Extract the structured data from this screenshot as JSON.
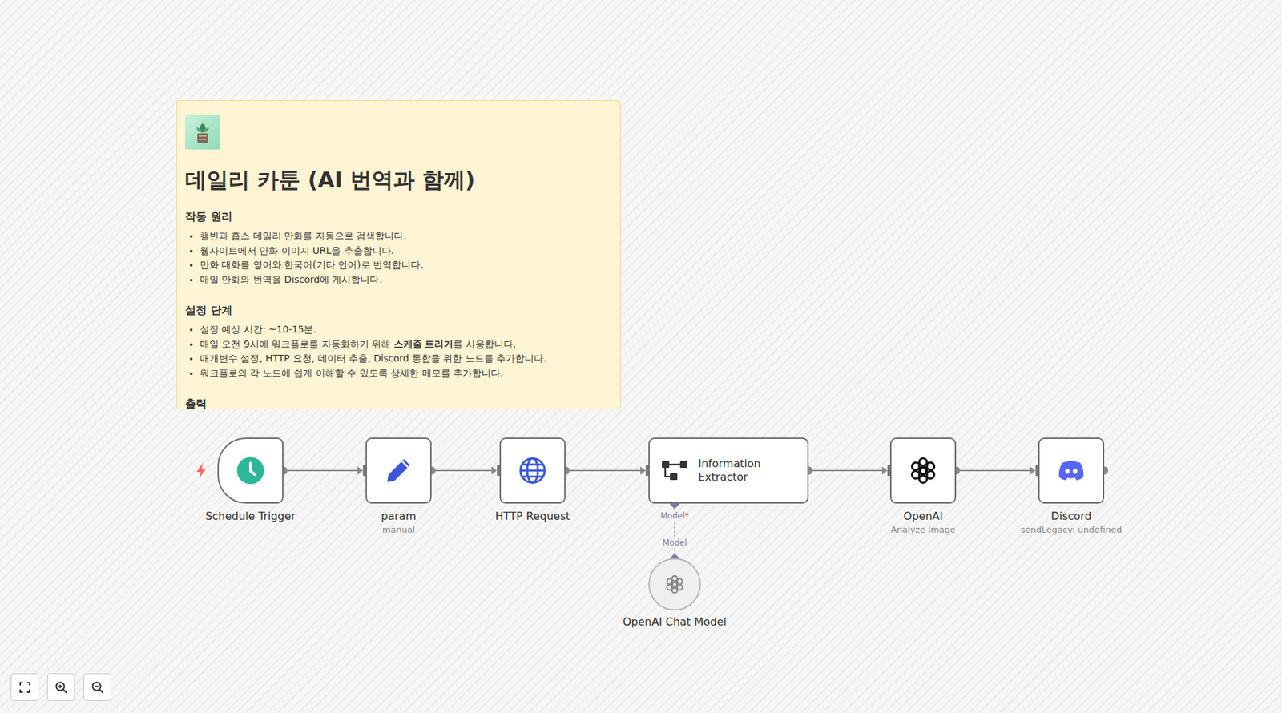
{
  "note": {
    "title": "데일리 카툰 (AI 번역과 함께)",
    "sections": [
      {
        "heading": "작동 원리",
        "items": [
          [
            {
              "text": "캘빈과 홉스 데일리 만화를 자동으로 검색합니다.",
              "bold": false
            }
          ],
          [
            {
              "text": "웹사이트에서 만화 이미지 URL을 추출합니다.",
              "bold": false
            }
          ],
          [
            {
              "text": "만화 대화를 영어와 한국어(기타 언어)로 번역합니다.",
              "bold": false
            }
          ],
          [
            {
              "text": "매일 만화와 번역을 Discord에 게시합니다.",
              "bold": false
            }
          ]
        ]
      },
      {
        "heading": "설정 단계",
        "items": [
          [
            {
              "text": "설정 예상 시간: ~10-15분.",
              "bold": false
            }
          ],
          [
            {
              "text": "매일 오전 9시에 워크플로를 자동화하기 위해 ",
              "bold": false
            },
            {
              "text": "스케줄 트리거",
              "bold": true
            },
            {
              "text": "를 사용합니다.",
              "bold": false
            }
          ],
          [
            {
              "text": "매개변수 설정, HTTP 요청, 데이터 추출, Discord 통합을 위한 노드를 추가합니다.",
              "bold": false
            }
          ],
          [
            {
              "text": "워크플로의 각 노드에 쉽게 이해할 수 있도록 상세한 메모를 추가합니다.",
              "bold": false
            }
          ]
        ]
      },
      {
        "heading": "출력",
        "items": []
      }
    ]
  },
  "nodes": [
    {
      "label": "Schedule Trigger",
      "kind": "schedule"
    },
    {
      "label": "param",
      "subtitle": "manual",
      "kind": "set"
    },
    {
      "label": "HTTP Request",
      "kind": "http"
    },
    {
      "label": "Information Extractor",
      "kind": "extractor"
    },
    {
      "label": "OpenAI",
      "subtitle": "Analyze Image",
      "kind": "openai"
    },
    {
      "label": "Discord",
      "subtitle": "sendLegacy: undefined",
      "kind": "discord"
    }
  ],
  "sub_node": {
    "label": "OpenAI Chat Model",
    "kind": "chat-model"
  },
  "model_port": {
    "label": "Model",
    "required_mark": "*"
  },
  "sub_node_port": {
    "label": "Model"
  },
  "controls": [
    {
      "kind": "fit"
    },
    {
      "kind": "zoom-in"
    },
    {
      "kind": "zoom-out"
    }
  ]
}
